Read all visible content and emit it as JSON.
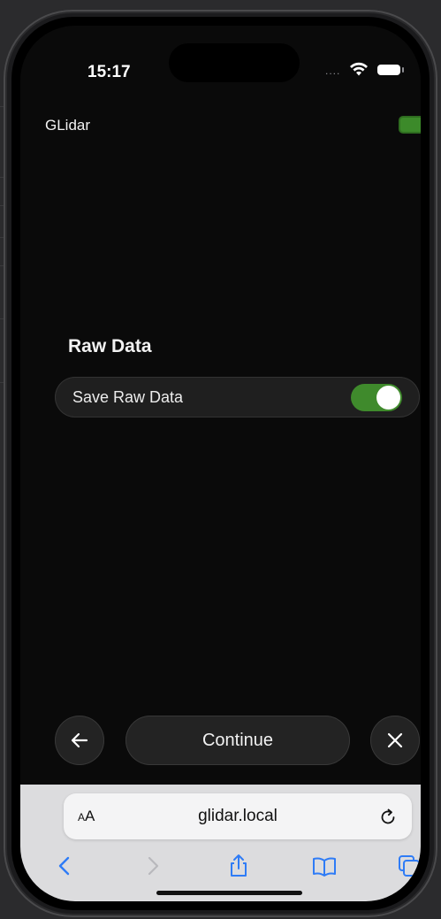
{
  "status_bar": {
    "time": "15:17",
    "signal_dots": "....",
    "wifi_icon": "wifi-icon",
    "battery_icon": "battery-icon"
  },
  "header": {
    "title": "GLidar",
    "device_battery_icon": "battery-full-icon",
    "device_battery_color": "#3c8a2a"
  },
  "raw_data": {
    "heading": "Raw Data",
    "toggle_label": "Save Raw Data",
    "toggle_on": true,
    "toggle_color": "#3f8a2c"
  },
  "nav": {
    "back_icon": "arrow-left-icon",
    "continue_label": "Continue",
    "close_icon": "close-icon"
  },
  "browser": {
    "aa_label_small": "A",
    "aa_label_large": "A",
    "url": "glidar.local",
    "reload_icon": "reload-icon",
    "accent_color": "#2f7cf6",
    "toolbar": {
      "back_icon": "chevron-left-icon",
      "forward_icon": "chevron-right-icon",
      "share_icon": "share-icon",
      "bookmarks_icon": "book-icon",
      "tabs_icon": "tabs-icon"
    }
  }
}
